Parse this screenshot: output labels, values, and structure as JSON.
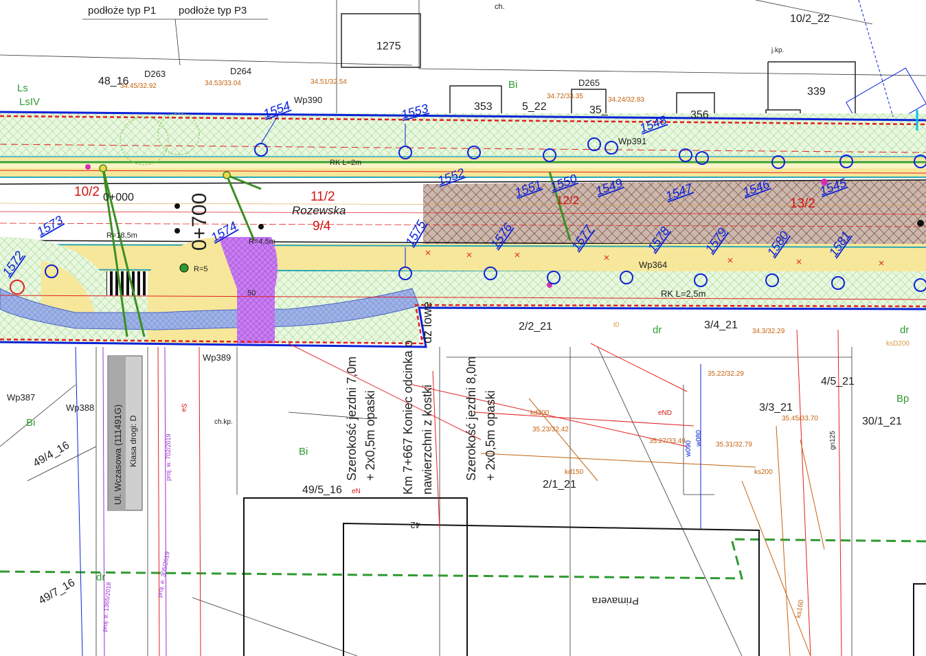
{
  "header": {
    "subgrade_p1": "podłoże typ P1",
    "subgrade_p3": "podłoże typ P3"
  },
  "colors": {
    "boundary_blue": "#0b22d8",
    "hatch_green": "#8fd27a",
    "road_yellow": "#f6e79a",
    "pavement_hatch": "#7a4a3a",
    "crossing_purple": "#a24bd6",
    "bike_path_blue": "#7b95d6",
    "elevation_text": "#c4620f",
    "utility_red": "#e02020"
  },
  "road": {
    "name": "Rozewska",
    "chainage_start": "0+000",
    "chainage_km": "0+700",
    "plot_left": "10/2",
    "plot_mid": "11/2",
    "plot_mid2": "9/4",
    "plot_right": "13/2",
    "plot_right2": "12/2",
    "curve_radius": "R=18,5m",
    "rk_label": "RK L=2,5m",
    "rk_label_top": "RK L=2m"
  },
  "trees": [
    "1554",
    "1553",
    "1552",
    "1551",
    "1550",
    "1549",
    "1548",
    "1547",
    "1546",
    "1545",
    "1573",
    "1574",
    "1575",
    "1576",
    "1577",
    "1578",
    "1579",
    "1580",
    "1581",
    "1572"
  ],
  "buildings": [
    "1275",
    "353",
    "35_",
    "356",
    "339",
    "10/2_22"
  ],
  "wells": [
    "D263",
    "D264",
    "D265",
    "Wp390",
    "Wp391",
    "Wp389",
    "Wp388",
    "Wp387",
    "Wp364"
  ],
  "elevations_top": [
    "34.45/32.92",
    "34.53/33.04",
    "34.72/33.35",
    "34.51/32.54",
    "34.24/32.83"
  ],
  "elevations_right": [
    "35.45/33.70",
    "35.31/32.79",
    "35.27/33.49",
    "35.23/32.42",
    "35.22/32.29",
    "34.3/32.29"
  ],
  "parcels": [
    "48_16",
    "49/4_16",
    "49/5_16",
    "49/7_16",
    "2/1_21",
    "2/2_21",
    "3/3_21",
    "3/4_21",
    "4/5_21",
    "30/1_21",
    "5_22"
  ],
  "land_classes": [
    "Ls",
    "LsIV",
    "Bi",
    "Bi",
    "Bi",
    "Bp",
    "dr",
    "dr",
    "dr"
  ],
  "side_street": {
    "name": "Ul. Wczasowa (111491G)",
    "class": "Klasa drogi: D"
  },
  "annotations": {
    "width_1": "Szerokość jezdni 7,0m",
    "width_1b": "+ 2x0,5m opaski",
    "end_segment": "Km 7+667 Koniec odcinka o",
    "end_segment_b": "nawierzchni z kostki",
    "end_segment_c": "dz  lowe",
    "width_2": "Szerokość jezdni 8,0m",
    "width_2b": "+ 2x0,5m opaski"
  },
  "utilities": [
    "eN",
    "eND",
    "eS",
    "kd200",
    "ks200",
    "ks160",
    "kd150",
    "w080",
    "w090",
    "gn125",
    "ch.kp.",
    "j.kp.",
    "t0",
    "ksD200",
    "proj. w. 702/2019",
    "proj. e. 305/2019",
    "proj. e. 1365/2018"
  ],
  "labels_misc": {
    "primavera": "Primavera",
    "ch": "ch.",
    "num_42": "42",
    "num_50": "50",
    "r5": "R=5",
    "r_label_2": "R=4,5m"
  }
}
